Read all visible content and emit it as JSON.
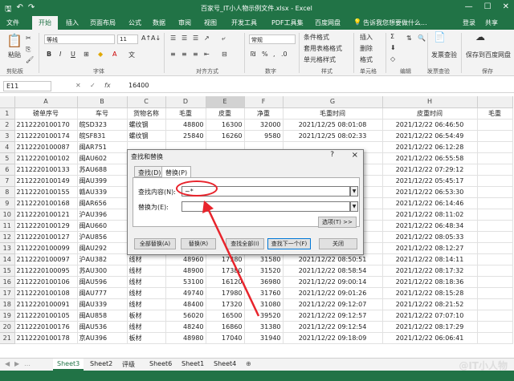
{
  "window": {
    "title": "百家号_IT小人物示例文件.xlsx - Excel",
    "min_icon": "minimize-icon",
    "max_icon": "maximize-icon",
    "close_icon": "close-icon"
  },
  "menu": {
    "items": [
      "文件",
      "开始",
      "插入",
      "页面布局",
      "公式",
      "数据",
      "审阅",
      "视图",
      "开发工具",
      "PDF工具集",
      "百度网盘"
    ],
    "tell_me": "告诉我您想要做什么...",
    "login": "登录",
    "share": "共享"
  },
  "ribbon": {
    "paste": "粘贴",
    "clipboard": "剪贴板",
    "font_group": "字体",
    "align_group": "对齐方式",
    "number_group": "数字",
    "style_group": "样式",
    "cells_group": "单元格",
    "edit_group": "编辑",
    "invoice_group": "发票查验",
    "save_group": "保存",
    "font_name": "等线",
    "font_size": "11",
    "number_format": "常规",
    "cond_format": "条件格式",
    "table_format": "套用表格格式",
    "cell_style": "单元格样式",
    "insert": "插入",
    "delete": "删除",
    "format": "格式",
    "invoice": "发票查验",
    "save_baidu": "保存到百度网盘",
    "bold": "B",
    "italic": "I",
    "underline": "U"
  },
  "formula_bar": {
    "name_box": "E11",
    "cancel": "✕",
    "enter": "✓",
    "fx": "fx",
    "value": "16400"
  },
  "grid": {
    "col_letters": [
      "A",
      "B",
      "C",
      "D",
      "E",
      "F",
      "G",
      "H",
      ""
    ],
    "headers": [
      "磅单序号",
      "车号",
      "货物名称",
      "毛重",
      "皮重",
      "净重",
      "毛重时间",
      "皮重时间",
      "毛重"
    ],
    "rows": [
      {
        "n": "2",
        "a": "2112220100170",
        "b": "皖SD323",
        "c": "螺纹钢",
        "d": "48800",
        "e": "16300",
        "f": "32000",
        "g": "2021/12/25 08:01:08",
        "h": "2021/12/22 06:46:50"
      },
      {
        "n": "3",
        "a": "2112220100174",
        "b": "皖SF831",
        "c": "螺纹钢",
        "d": "25840",
        "e": "16260",
        "f": "9580",
        "g": "2021/12/25 08:02:33",
        "h": "2021/12/22 06:54:49"
      },
      {
        "n": "4",
        "a": "2112220100087",
        "b": "闽AR751",
        "c": "",
        "d": "",
        "e": "",
        "f": "",
        "g": "",
        "h": "2021/12/22 06:12:28"
      },
      {
        "n": "5",
        "a": "2112220100102",
        "b": "闽AU602",
        "c": "",
        "d": "",
        "e": "",
        "f": "",
        "g": "",
        "h": "2021/12/22 06:55:58"
      },
      {
        "n": "6",
        "a": "2112220100133",
        "b": "苏AU688",
        "c": "",
        "d": "",
        "e": "",
        "f": "",
        "g": "",
        "h": "2021/12/22 07:29:12"
      },
      {
        "n": "7",
        "a": "2112220100149",
        "b": "闽AU399",
        "c": "",
        "d": "",
        "e": "",
        "f": "",
        "g": "",
        "h": "2021/12/22 05:45:17"
      },
      {
        "n": "8",
        "a": "2112220100155",
        "b": "赣AU339",
        "c": "",
        "d": "",
        "e": "",
        "f": "",
        "g": "",
        "h": "2021/12/22 06:53:30"
      },
      {
        "n": "9",
        "a": "2112220100168",
        "b": "闽AR656",
        "c": "",
        "d": "",
        "e": "",
        "f": "",
        "g": "",
        "h": "2021/12/22 06:14:46"
      },
      {
        "n": "10",
        "a": "2112220100121",
        "b": "沪AU396",
        "c": "",
        "d": "",
        "e": "",
        "f": "",
        "g": "",
        "h": "2021/12/22 08:11:02"
      },
      {
        "n": "11",
        "a": "2112220100129",
        "b": "闽AU660",
        "c": "",
        "d": "",
        "e": "",
        "f": "",
        "g": "",
        "h": "2021/12/22 06:48:34"
      },
      {
        "n": "12",
        "a": "2112220100127",
        "b": "沪AU856",
        "c": "",
        "d": "",
        "e": "",
        "f": "",
        "g": "",
        "h": "2021/12/22 08:05:33"
      },
      {
        "n": "13",
        "a": "2112220100099",
        "b": "闽AU292",
        "c": "",
        "d": "",
        "e": "",
        "f": "",
        "g": "",
        "h": "2021/12/22 08:12:27"
      },
      {
        "n": "14",
        "a": "2112220100097",
        "b": "沪AU382",
        "c": "线材",
        "d": "48960",
        "e": "17380",
        "f": "31580",
        "g": "2021/12/22 08:50:51",
        "h": "2021/12/22 08:14:11"
      },
      {
        "n": "15",
        "a": "2112220100095",
        "b": "苏AU300",
        "c": "线材",
        "d": "48900",
        "e": "17380",
        "f": "31520",
        "g": "2021/12/22 08:58:54",
        "h": "2021/12/22 08:17:32"
      },
      {
        "n": "16",
        "a": "2112220100106",
        "b": "闽AU596",
        "c": "线材",
        "d": "53100",
        "e": "16120",
        "f": "36980",
        "g": "2021/12/22 09:00:14",
        "h": "2021/12/22 08:18:36"
      },
      {
        "n": "17",
        "a": "2112220100108",
        "b": "闽AU777",
        "c": "线材",
        "d": "49740",
        "e": "17980",
        "f": "31760",
        "g": "2021/12/22 09:01:26",
        "h": "2021/12/22 08:15:28"
      },
      {
        "n": "18",
        "a": "2112220100091",
        "b": "闽AU339",
        "c": "线材",
        "d": "48400",
        "e": "17320",
        "f": "31080",
        "g": "2021/12/22 09:12:07",
        "h": "2021/12/22 08:21:52"
      },
      {
        "n": "19",
        "a": "2112220100105",
        "b": "闽AU858",
        "c": "板材",
        "d": "56020",
        "e": "16500",
        "f": "39520",
        "g": "2021/12/22 09:12:57",
        "h": "2021/12/22 07:07:10"
      },
      {
        "n": "20",
        "a": "2112220100176",
        "b": "闽AU536",
        "c": "线材",
        "d": "48240",
        "e": "16860",
        "f": "31380",
        "g": "2021/12/22 09:12:54",
        "h": "2021/12/22 08:17:29"
      },
      {
        "n": "21",
        "a": "2112220100178",
        "b": "京AU396",
        "c": "板材",
        "d": "48980",
        "e": "17040",
        "f": "31940",
        "g": "2021/12/22 09:18:09",
        "h": "2021/12/22 06:06:41"
      }
    ]
  },
  "dialog": {
    "title": "查找和替换",
    "help": "?",
    "close": "×",
    "tab_find": "查找(D)",
    "tab_replace": "替换(P)",
    "find_label": "查找内容(N):",
    "find_value": "~*",
    "replace_label": "替换为(E):",
    "replace_value": "",
    "options": "选项(T) >>",
    "replace_all": "全部替换(A)",
    "replace": "替换(R)",
    "find_all": "查找全部(I)",
    "find_next": "查找下一个(F)",
    "close_btn": "关闭"
  },
  "sheets": {
    "tabs": [
      "Sheet3",
      "Sheet2",
      "评级",
      "Sheet6",
      "Sheet1",
      "Sheet4"
    ],
    "add": "⊕"
  },
  "watermark": "@IT小人物",
  "colors": {
    "accent": "#217346",
    "annotation": "#e8242c"
  }
}
